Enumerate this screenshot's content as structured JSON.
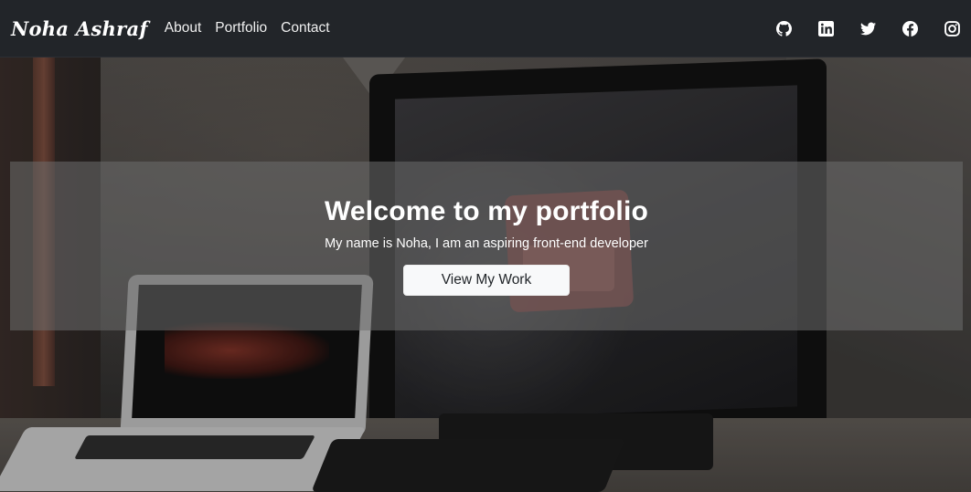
{
  "navbar": {
    "brand": "Noha Ashraf",
    "links": [
      {
        "label": "About"
      },
      {
        "label": "Portfolio"
      },
      {
        "label": "Contact"
      }
    ],
    "social_icons": [
      "github-icon",
      "linkedin-icon",
      "twitter-icon",
      "facebook-icon",
      "instagram-icon"
    ]
  },
  "hero": {
    "title": "Welcome to my portfolio",
    "subtitle": "My name is Noha, I am an aspiring front-end developer",
    "cta_label": "View My Work"
  },
  "colors": {
    "navbar_bg": "#222529",
    "band_bg": "rgba(110,110,110,0.55)",
    "button_bg": "#f8f9fa",
    "text_light": "#ffffff"
  }
}
